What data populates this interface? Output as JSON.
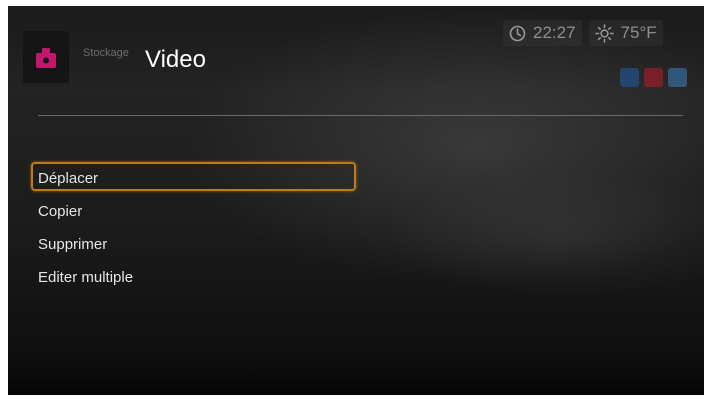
{
  "header": {
    "source_label": "Stockage",
    "title": "Video"
  },
  "status": {
    "clock_icon": "clock-icon",
    "time": "22:27",
    "weather_icon": "sun-icon",
    "temperature": "75°F"
  },
  "menu": {
    "selected_index": 0,
    "items": [
      {
        "label": "Déplacer"
      },
      {
        "label": "Copier"
      },
      {
        "label": "Supprimer"
      },
      {
        "label": "Editer multiple"
      }
    ]
  },
  "colors": {
    "focus_border": "#c07a18",
    "app_icon_accent": "#c2186b",
    "mini_icon_1": "#1d5fa6",
    "mini_icon_2": "#c0182a",
    "mini_icon_3": "#3a7fc0"
  }
}
